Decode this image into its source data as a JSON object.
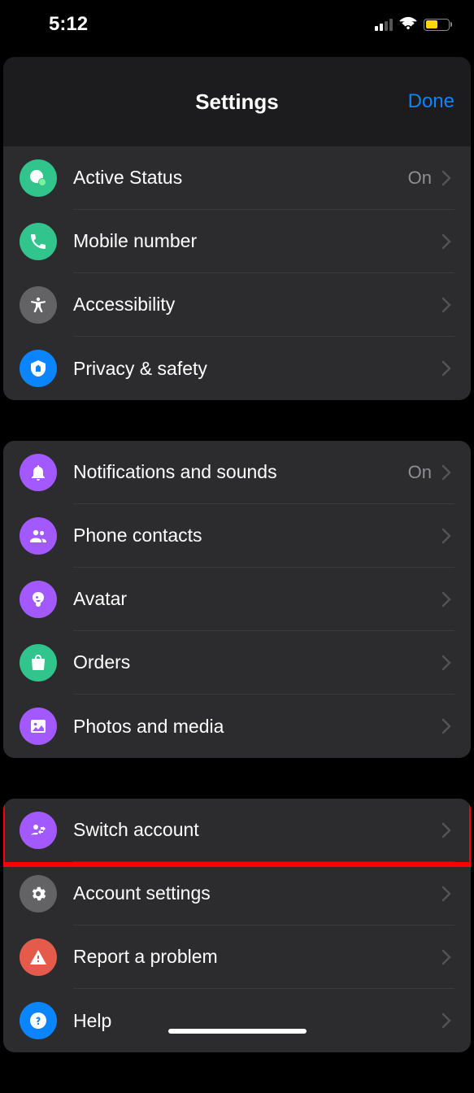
{
  "status": {
    "time": "5:12"
  },
  "header": {
    "title": "Settings",
    "done": "Done"
  },
  "sections": [
    {
      "rows": [
        {
          "label": "Active Status",
          "value": "On",
          "icon": "active-status-icon",
          "bg": "ic-green"
        },
        {
          "label": "Mobile number",
          "value": "",
          "icon": "phone-icon",
          "bg": "ic-greenalt"
        },
        {
          "label": "Accessibility",
          "value": "",
          "icon": "accessibility-icon",
          "bg": "ic-gray"
        },
        {
          "label": "Privacy & safety",
          "value": "",
          "icon": "shield-home-icon",
          "bg": "ic-blue"
        }
      ]
    },
    {
      "rows": [
        {
          "label": "Notifications and sounds",
          "value": "On",
          "icon": "bell-icon",
          "bg": "ic-purple"
        },
        {
          "label": "Phone contacts",
          "value": "",
          "icon": "contacts-icon",
          "bg": "ic-purplealt"
        },
        {
          "label": "Avatar",
          "value": "",
          "icon": "avatar-icon",
          "bg": "ic-purple"
        },
        {
          "label": "Orders",
          "value": "",
          "icon": "bag-icon",
          "bg": "ic-green"
        },
        {
          "label": "Photos and media",
          "value": "",
          "icon": "image-icon",
          "bg": "ic-purplealt"
        }
      ]
    },
    {
      "rows": [
        {
          "label": "Switch account",
          "value": "",
          "icon": "switch-account-icon",
          "bg": "ic-purple",
          "highlight": true
        },
        {
          "label": "Account settings",
          "value": "",
          "icon": "gear-icon",
          "bg": "ic-gray"
        },
        {
          "label": "Report a problem",
          "value": "",
          "icon": "alert-icon",
          "bg": "ic-orange"
        },
        {
          "label": "Help",
          "value": "",
          "icon": "help-icon",
          "bg": "ic-blue"
        }
      ]
    }
  ]
}
